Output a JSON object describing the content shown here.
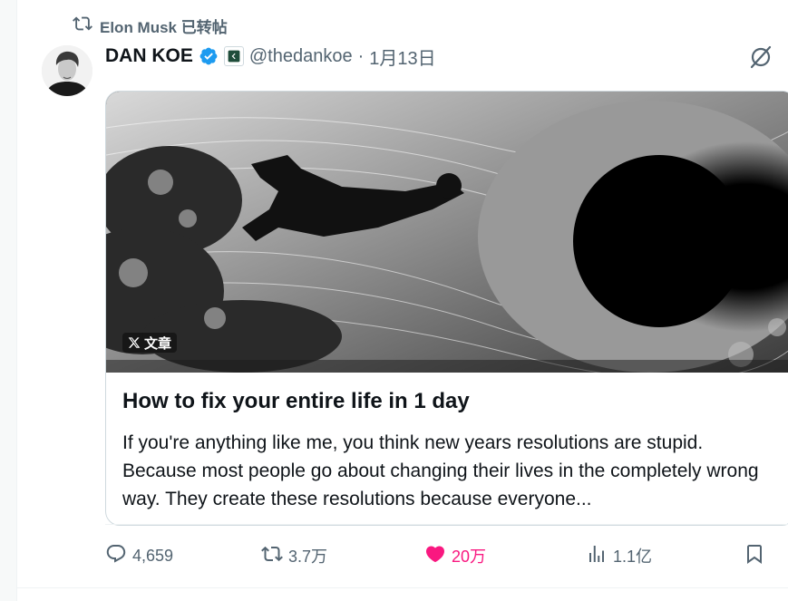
{
  "repost": {
    "label": "Elon Musk 已转帖"
  },
  "tweet": {
    "author": {
      "display_name": "DAN KOE",
      "handle": "@thedankoe",
      "separator": "·",
      "date": "1月13日"
    },
    "card": {
      "badge_label": "文章",
      "title": "How to fix your entire life in 1 day",
      "excerpt": "If you're anything like me, you think new years resolutions are stupid. Because most people go about changing their lives in the completely wrong way. They create these resolutions because everyone..."
    },
    "actions": {
      "replies": "4,659",
      "reposts": "3.7万",
      "likes": "20万",
      "views": "1.1亿"
    }
  },
  "colors": {
    "like_active": "#f91880",
    "verified_blue": "#1d9bf0",
    "muted_text": "#536471"
  },
  "icons": [
    "repost-icon",
    "verified-icon",
    "affiliate-icon",
    "grok-icon",
    "x-logo-icon",
    "reply-icon",
    "retweet-icon",
    "heart-icon",
    "views-icon",
    "bookmark-icon"
  ]
}
